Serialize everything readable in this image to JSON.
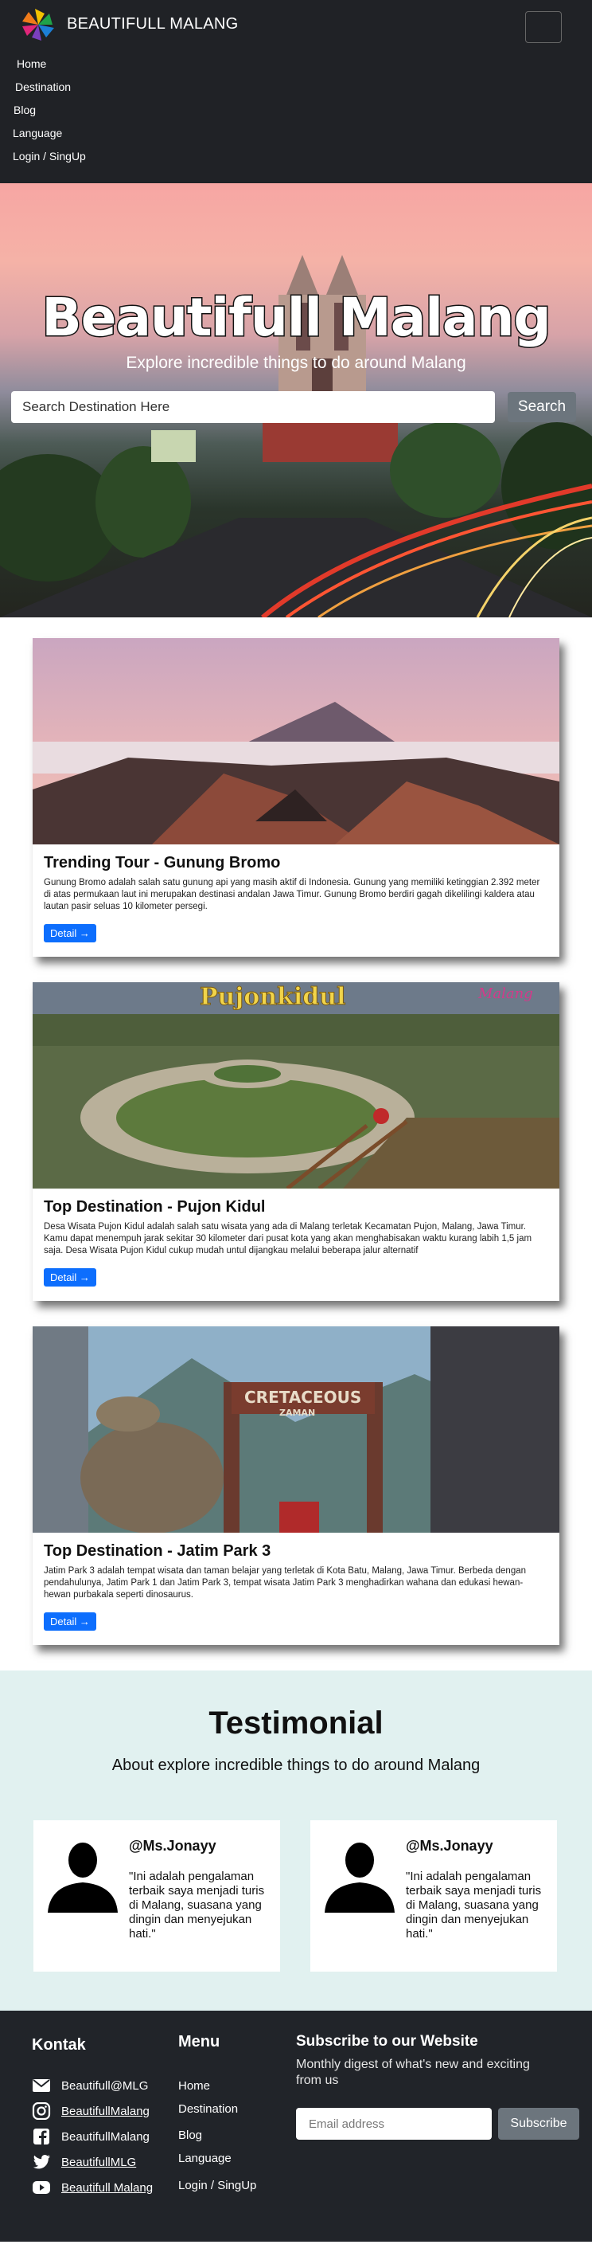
{
  "navbar": {
    "brand": "BEAUTIFULL MALANG",
    "items": [
      "Home",
      "Destination",
      "Blog",
      "Language",
      "Login / SingUp"
    ]
  },
  "hero": {
    "title": "Beautifull Malang",
    "subtitle": "Explore incredible things to do around Malang",
    "search_placeholder": "Search Destination Here",
    "search_button": "Search"
  },
  "cards": [
    {
      "title": "Trending Tour - Gunung Bromo",
      "text": "Gunung Bromo adalah salah satu gunung api yang masih aktif di Indonesia. Gunung yang memiliki ketinggian 2.392 meter di atas permukaan laut ini merupakan destinasi andalan Jawa Timur. Gunung Bromo berdiri gagah dikelilingi kaldera atau lautan pasir seluas 10 kilometer persegi.",
      "button": "Detail →",
      "image": "bromo"
    },
    {
      "title": "Top Destination - Pujon Kidul",
      "text": "Desa Wisata Pujon Kidul adalah salah satu wisata yang ada di Malang terletak Kecamatan Pujon, Malang, Jawa Timur. Kamu dapat menempuh jarak sekitar 30 kilometer dari pusat kota yang akan menghabisakan waktu kurang labih 1,5 jam saja. Desa Wisata Pujon Kidul cukup mudah untul dijangkau melalui beberapa jalur alternatif",
      "button": "Detail →",
      "image": "pujon",
      "image_text": "Pujonkidul",
      "image_text_2": "Malang"
    },
    {
      "title": "Top Destination - Jatim Park 3",
      "text": "Jatim Park 3 adalah tempat wisata dan taman belajar yang terletak di Kota Batu, Malang, Jawa Timur. Berbeda dengan pendahulunya, Jatim Park 1 dan Jatim Park 3, tempat wisata Jatim Park 3 menghadirkan wahana dan edukasi hewan-hewan purbakala seperti dinosaurus.",
      "button": "Detail →",
      "image": "jatimpark",
      "image_text": "CRETACEOUS",
      "image_text_2": "ZAMAN"
    }
  ],
  "testimonial": {
    "title": "Testimonial",
    "subtitle": "About explore incredible things to do around Malang",
    "items": [
      {
        "name": "@Ms.Jonayy",
        "quote": "\"Ini adalah pengalaman terbaik saya menjadi turis di Malang, suasana yang dingin dan menyejukan hati.\""
      },
      {
        "name": "@Ms.Jonayy",
        "quote": "\"Ini adalah pengalaman terbaik saya menjadi turis di Malang, suasana yang dingin dan menyejukan hati.\""
      }
    ]
  },
  "footer": {
    "kontak_heading": "Kontak",
    "contacts": [
      {
        "icon": "envelope-icon",
        "label": "Beautifull@MLG",
        "link": false
      },
      {
        "icon": "instagram-icon",
        "label": "BeautifullMalang",
        "link": true
      },
      {
        "icon": "facebook-icon",
        "label": "BeautifullMalang",
        "link": false
      },
      {
        "icon": "twitter-icon",
        "label": "BeautifullMLG",
        "link": true
      },
      {
        "icon": "youtube-icon",
        "label": "Beautifull Malang",
        "link": true
      }
    ],
    "menu_heading": "Menu",
    "menu": [
      "Home",
      "Destination",
      "Blog",
      "Language",
      "Login / SingUp"
    ],
    "subscribe_heading": "Subscribe to our Website",
    "subscribe_text": "Monthly digest of what's new and exciting from us",
    "email_placeholder": "Email address",
    "subscribe_button": "Subscribe"
  }
}
